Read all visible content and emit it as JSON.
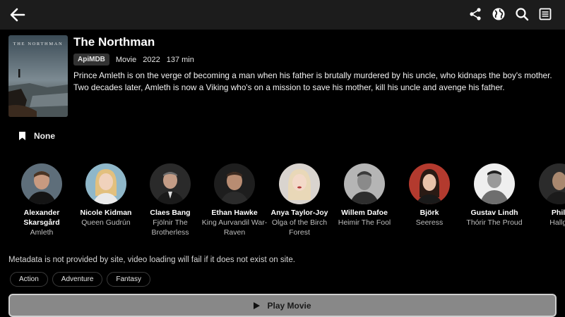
{
  "movie": {
    "title": "The Northman",
    "poster_title": "THE NORTHMAN",
    "source_badge": "ApiMDB",
    "type": "Movie",
    "year": "2022",
    "runtime": "137 min",
    "overview": "Prince Amleth is on the verge of becoming a man when his father is brutally murdered by his uncle, who kidnaps the boy's mother. Two decades later, Amleth is now a Viking who's on a mission to save his mother, kill his uncle and avenge his father."
  },
  "bookmark": {
    "label": "None",
    "icon": "bookmark-icon"
  },
  "cast": [
    {
      "name": "Alexander Skarsgård",
      "role": "Amleth"
    },
    {
      "name": "Nicole Kidman",
      "role": "Queen Gudrún"
    },
    {
      "name": "Claes Bang",
      "role": "Fjölnir The Brotherless"
    },
    {
      "name": "Ethan Hawke",
      "role": "King Aurvandil War-Raven"
    },
    {
      "name": "Anya Taylor-Joy",
      "role": "Olga of the Birch Forest"
    },
    {
      "name": "Willem Dafoe",
      "role": "Heimir The Fool"
    },
    {
      "name": "Björk",
      "role": "Seeress"
    },
    {
      "name": "Gustav Lindh",
      "role": "Thórir The Proud"
    },
    {
      "name": "Phill",
      "role": "Hallgr"
    }
  ],
  "notice": "Metadata is not provided by site, video loading will fail if it does not exist on site.",
  "genres": [
    "Action",
    "Adventure",
    "Fantasy"
  ],
  "play_button": {
    "label": "Play Movie"
  },
  "toolbar_icons": [
    "back-arrow-icon",
    "share-icon",
    "globe-icon",
    "search-icon",
    "list-icon"
  ],
  "colors": {
    "background": "#000000",
    "topbar": "#1c1c1c",
    "play_button": "#888888",
    "badge": "#333333"
  }
}
